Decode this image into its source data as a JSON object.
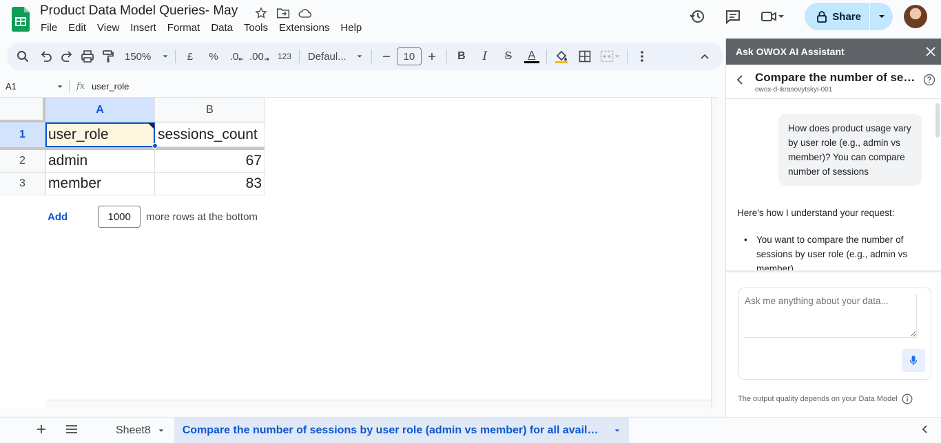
{
  "document": {
    "title": "Product Data Model Queries- May"
  },
  "menu": [
    "File",
    "Edit",
    "View",
    "Insert",
    "Format",
    "Data",
    "Tools",
    "Extensions",
    "Help"
  ],
  "share": {
    "label": "Share"
  },
  "toolbar": {
    "zoom": "150%",
    "currency": "£",
    "percent": "%",
    "decrease_decimal": ".0",
    "increase_decimal": ".00",
    "number_format": "123",
    "font": "Defaul...",
    "font_size": "10",
    "bold": "B",
    "italic": "I",
    "strikethrough": "S",
    "text_color": "A"
  },
  "formula_bar": {
    "cell_ref": "A1",
    "fx": "fx",
    "content": "user_role"
  },
  "grid": {
    "columns": [
      "A",
      "B"
    ],
    "rows": [
      {
        "num": "1",
        "a": "user_role",
        "b": "sessions_count"
      },
      {
        "num": "2",
        "a": "admin",
        "b": "67"
      },
      {
        "num": "3",
        "a": "member",
        "b": "83"
      }
    ],
    "add_rows": {
      "link": "Add",
      "count": "1000",
      "suffix": "more rows at the bottom"
    }
  },
  "tabs": {
    "inactive": "Sheet8",
    "active": "Compare the number of sessions by user role (admin vs member) for all available"
  },
  "panel": {
    "header": "Ask OWOX AI Assistant",
    "conversation_title": "Compare the number of sess...",
    "conversation_subtitle": "owox-d-ikrasovytskyi-001",
    "user_message": "How does product usage vary by user role (e.g., admin vs member)? You can compare number of sessions",
    "assistant_intro": "Here's how I understand your request:",
    "assistant_bullet": "You want to compare the number of sessions by user role (e.g., admin vs member)",
    "input_placeholder": "Ask me anything about your data...",
    "footer": "The output quality depends on your Data Model"
  },
  "colors": {
    "accent": "#0b57d0",
    "share_bg": "#c2e7ff",
    "active_cell_bg": "#fef7e0",
    "panel_header_bg": "#5f6368"
  }
}
